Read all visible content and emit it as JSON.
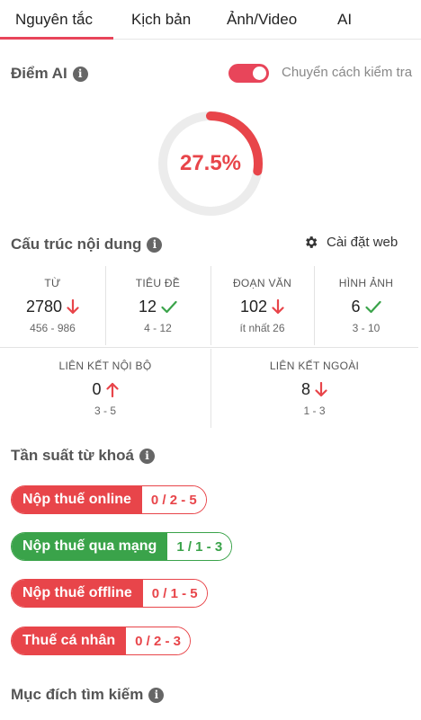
{
  "tabs": [
    {
      "label": "Nguyên tắc",
      "active": true
    },
    {
      "label": "Kịch bản"
    },
    {
      "label": "Ảnh/Video"
    },
    {
      "label": "AI"
    }
  ],
  "ai_score": {
    "title": "Điểm AI",
    "toggle_label": "Chuyển cách kiểm tra",
    "toggle_on": true,
    "percent_text": "27.5%",
    "percent_value": 27.5
  },
  "content_structure": {
    "title": "Cấu trúc nội dung",
    "settings_label": "Cài đặt web",
    "stats": [
      {
        "label": "TỪ",
        "value": "2780",
        "status": "down",
        "range": "456 - 986"
      },
      {
        "label": "TIÊU ĐỀ",
        "value": "12",
        "status": "ok",
        "range": "4 - 12"
      },
      {
        "label": "ĐOẠN VĂN",
        "value": "102",
        "status": "down",
        "range": "ít nhất 26"
      },
      {
        "label": "HÌNH ẢNH",
        "value": "6",
        "status": "ok",
        "range": "3 - 10"
      },
      {
        "label": "LIÊN KẾT NỘI BỘ",
        "value": "0",
        "status": "up",
        "range": "3 - 5"
      },
      {
        "label": "LIÊN KẾT NGOÀI",
        "value": "8",
        "status": "down",
        "range": "1 - 3"
      }
    ]
  },
  "keyword_frequency": {
    "title": "Tần suất từ khoá",
    "keywords": [
      {
        "name": "Nộp thuế online",
        "count": "0 / 2 - 5",
        "status": "bad"
      },
      {
        "name": "Nộp thuế qua mạng",
        "count": "1 / 1 - 3",
        "status": "good"
      },
      {
        "name": "Nộp thuế offline",
        "count": "0 / 1 - 5",
        "status": "bad"
      },
      {
        "name": "Thuế cá nhân",
        "count": "0 / 2 - 3",
        "status": "bad"
      }
    ]
  },
  "search_intent": {
    "title": "Mục đích tìm kiếm"
  },
  "colors": {
    "accent": "#e8455a",
    "bad": "#e8454a",
    "good": "#3aa34a"
  },
  "icons": {
    "info": "info-icon",
    "settings": "gear-icon",
    "arrow_down": "arrow-down-icon",
    "arrow_up": "arrow-up-icon",
    "check": "check-icon"
  }
}
